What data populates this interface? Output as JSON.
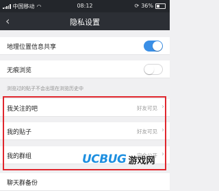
{
  "status_bar": {
    "carrier": "中国移动",
    "time": "08:12",
    "battery": "36%"
  },
  "nav": {
    "back_icon": "chevron-left-icon",
    "title": "隐私设置"
  },
  "settings": {
    "location_sharing": {
      "label": "地理位置信息共享",
      "enabled": true
    },
    "incognito": {
      "label": "无痕浏览",
      "enabled": false
    },
    "incognito_note": "浏览过的贴子不会出现在浏览历史中",
    "followed_bars": {
      "label": "我关注的吧",
      "value": "好友可见"
    },
    "my_posts": {
      "label": "我的贴子",
      "value": "好友可见"
    },
    "my_groups": {
      "label": "我的群组",
      "value": "完全公开"
    },
    "next_item": {
      "label": "聊天群备份"
    }
  },
  "watermark": {
    "latin": "UCBUG",
    "chinese": "游戏网"
  },
  "colors": {
    "toggle_on": "#3a8fe6",
    "highlight_border": "#e0262d",
    "nav_bg": "#2c2f35"
  }
}
